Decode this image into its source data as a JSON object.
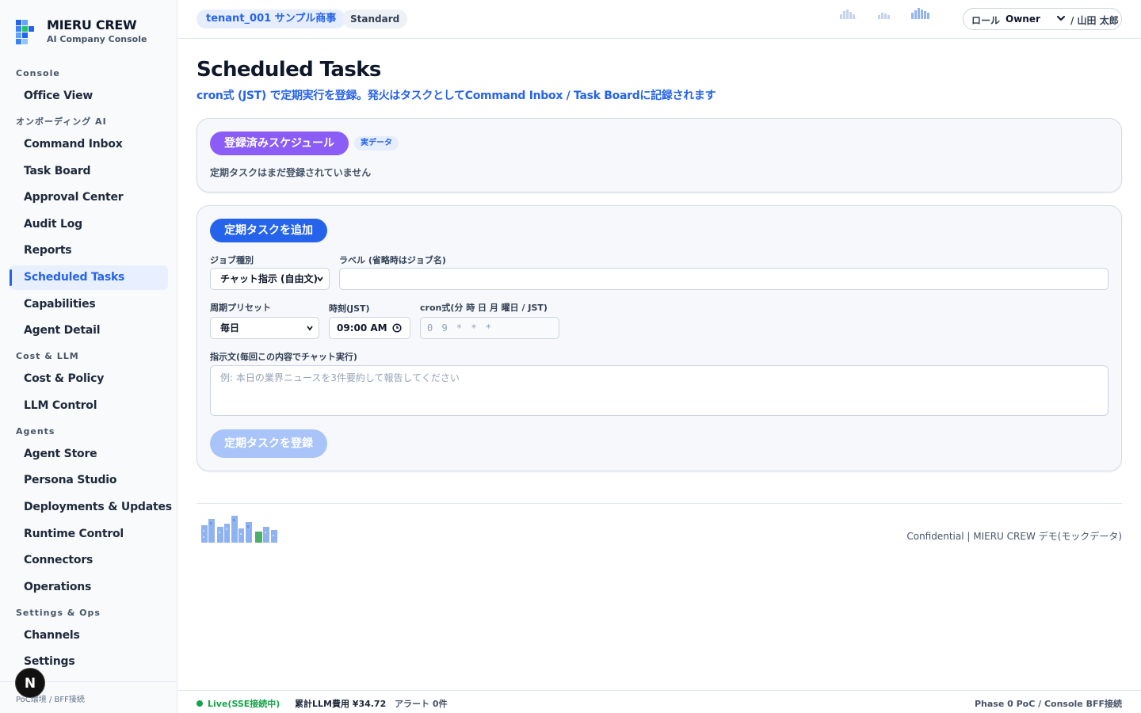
{
  "brand": {
    "title": "MIERU CREW",
    "subtitle": "AI Company Console"
  },
  "sidebar": {
    "sections": [
      {
        "title": "Console",
        "items": [
          "Office View"
        ]
      },
      {
        "title": "オンボーディング AI",
        "items": [
          "Command Inbox",
          "Task Board",
          "Approval Center",
          "Audit Log",
          "Reports",
          "Scheduled Tasks",
          "Capabilities",
          "Agent Detail"
        ]
      },
      {
        "title": "Cost & LLM",
        "items": [
          "Cost & Policy",
          "LLM Control"
        ]
      },
      {
        "title": "Agents",
        "items": [
          "Agent Store",
          "Persona Studio",
          "Deployments & Updates",
          "Runtime Control",
          "Connectors",
          "Operations"
        ]
      },
      {
        "title": "Settings & Ops",
        "items": [
          "Channels",
          "Settings"
        ]
      }
    ],
    "active_item": "Scheduled Tasks",
    "footer": "PoC環境 / BFF接続",
    "badge": "N"
  },
  "header": {
    "tenant": "tenant_001 サンプル商事",
    "plan": "Standard",
    "role_label": "ロール",
    "role_value": "Owner",
    "user": "/ 山田 太郎"
  },
  "page": {
    "title": "Scheduled Tasks",
    "subtitle": "cron式 (JST) で定期実行を登録。発火はタスクとしてCommand Inbox / Task Boardに記録されます"
  },
  "registered": {
    "heading": "登録済みスケジュール",
    "badge": "実データ",
    "empty": "定期タスクはまだ登録されていません"
  },
  "form": {
    "heading": "定期タスクを追加",
    "job_type_label": "ジョブ種別",
    "job_type_value": "チャット指示 (自由文)",
    "name_label": "ラベル (省略時はジョブ名)",
    "name_value": "",
    "preset_label": "周期プリセット",
    "preset_value": "毎日",
    "time_label": "時刻(JST)",
    "time_value": "09:00 AM",
    "cron_label": "cron式(分 時 日 月 曜日 / JST)",
    "cron_placeholder": "0 9 * * *",
    "instruction_label": "指示文(毎回この内容でチャット実行)",
    "instruction_placeholder": "例: 本日の業界ニュースを3件要約して報告してください",
    "submit_label": "定期タスクを登録"
  },
  "footer": {
    "confidential": "Confidential | MIERU CREW デモ(モックデータ)"
  },
  "statusbar": {
    "live": "Live(SSE接続中)",
    "cost": "累計LLM費用 ¥34.72",
    "alerts": "アラート 0件",
    "phase": "Phase 0 PoC / Console BFF接続"
  },
  "colors": {
    "accent": "#2563eb",
    "purple": "#8b5cf6",
    "live": "#16a34a"
  },
  "icons": [
    "city-skyline-icon",
    "chevron-down-icon",
    "clock-icon"
  ]
}
